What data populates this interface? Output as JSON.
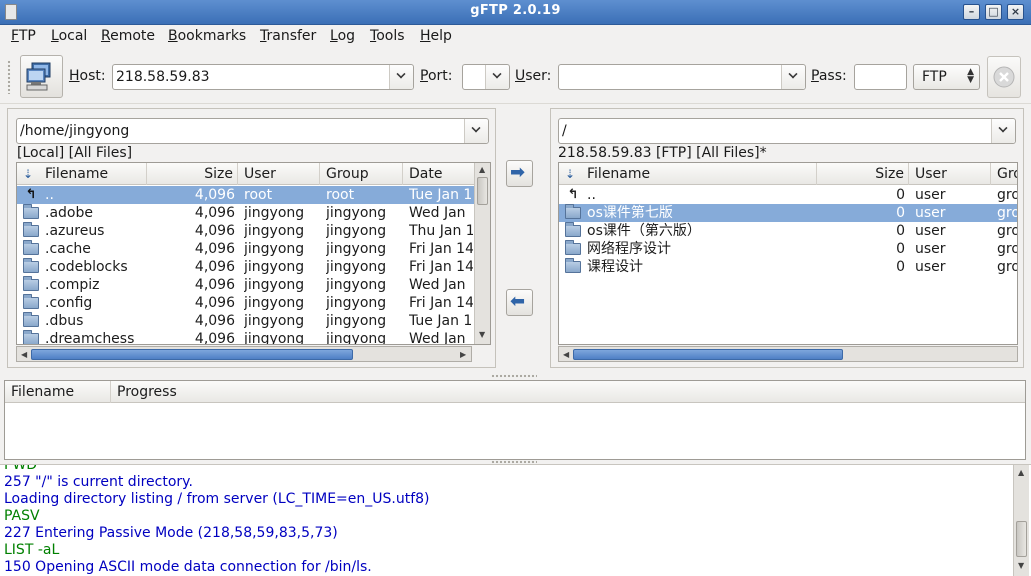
{
  "window": {
    "title": "gFTP 2.0.19"
  },
  "menu": [
    "FTP",
    "Local",
    "Remote",
    "Bookmarks",
    "Transfer",
    "Log",
    "Tools",
    "Help"
  ],
  "toolbar": {
    "host_label": "Host:",
    "host_value": "218.58.59.83",
    "port_label": "Port:",
    "port_value": "",
    "user_label": "User:",
    "user_value": "",
    "pass_label": "Pass:",
    "pass_value": "",
    "protocol": "FTP"
  },
  "local": {
    "path": "/home/jingyong",
    "status": "[Local] [All Files]",
    "columns": [
      "Filename",
      "Size",
      "User",
      "Group",
      "Date"
    ],
    "rows": [
      {
        "icon": "up",
        "name": "..",
        "size": "4,096",
        "user": "root",
        "group": "root",
        "date": "Tue Jan 1",
        "selected": true
      },
      {
        "icon": "folder",
        "name": ".adobe",
        "size": "4,096",
        "user": "jingyong",
        "group": "jingyong",
        "date": "Wed Jan",
        "selected": false
      },
      {
        "icon": "folder",
        "name": ".azureus",
        "size": "4,096",
        "user": "jingyong",
        "group": "jingyong",
        "date": "Thu Jan 1",
        "selected": false
      },
      {
        "icon": "folder",
        "name": ".cache",
        "size": "4,096",
        "user": "jingyong",
        "group": "jingyong",
        "date": "Fri Jan 14",
        "selected": false
      },
      {
        "icon": "folder",
        "name": ".codeblocks",
        "size": "4,096",
        "user": "jingyong",
        "group": "jingyong",
        "date": "Fri Jan 14",
        "selected": false
      },
      {
        "icon": "folder",
        "name": ".compiz",
        "size": "4,096",
        "user": "jingyong",
        "group": "jingyong",
        "date": "Wed Jan",
        "selected": false
      },
      {
        "icon": "folder",
        "name": ".config",
        "size": "4,096",
        "user": "jingyong",
        "group": "jingyong",
        "date": "Fri Jan 14",
        "selected": false
      },
      {
        "icon": "folder",
        "name": ".dbus",
        "size": "4,096",
        "user": "jingyong",
        "group": "jingyong",
        "date": "Tue Jan 1",
        "selected": false
      },
      {
        "icon": "folder",
        "name": ".dreamchess",
        "size": "4,096",
        "user": "jingyong",
        "group": "jingyong",
        "date": "Wed Jan",
        "selected": false
      }
    ]
  },
  "remote": {
    "path": "/",
    "status": "218.58.59.83 [FTP] [All Files]*",
    "columns": [
      "Filename",
      "Size",
      "User",
      "Gro"
    ],
    "rows": [
      {
        "icon": "up",
        "name": "..",
        "size": "0",
        "user": "user",
        "group": "gro",
        "selected": false
      },
      {
        "icon": "folder",
        "name": "os课件第七版",
        "size": "0",
        "user": "user",
        "group": "gro",
        "selected": true
      },
      {
        "icon": "folder",
        "name": "os课件（第六版）",
        "size": "0",
        "user": "user",
        "group": "gro",
        "selected": false
      },
      {
        "icon": "folder",
        "name": "网络程序设计",
        "size": "0",
        "user": "user",
        "group": "gro",
        "selected": false
      },
      {
        "icon": "folder",
        "name": "课程设计",
        "size": "0",
        "user": "user",
        "group": "gro",
        "selected": false
      }
    ]
  },
  "transfers": {
    "columns": [
      "Filename",
      "Progress"
    ]
  },
  "log": [
    {
      "type": "cmd",
      "text": "PWD"
    },
    {
      "type": "resp",
      "text": "257 \"/\" is current directory."
    },
    {
      "type": "resp",
      "text": "Loading directory listing / from server (LC_TIME=en_US.utf8)"
    },
    {
      "type": "cmd",
      "text": "PASV"
    },
    {
      "type": "resp",
      "text": "227 Entering Passive Mode (218,58,59,83,5,73)"
    },
    {
      "type": "cmd",
      "text": "LIST -aL"
    },
    {
      "type": "resp",
      "text": "150 Opening ASCII mode data connection for /bin/ls."
    }
  ],
  "colors": {
    "selection": "#86abd9",
    "log_command": "#008000",
    "log_response": "#0000c0"
  }
}
